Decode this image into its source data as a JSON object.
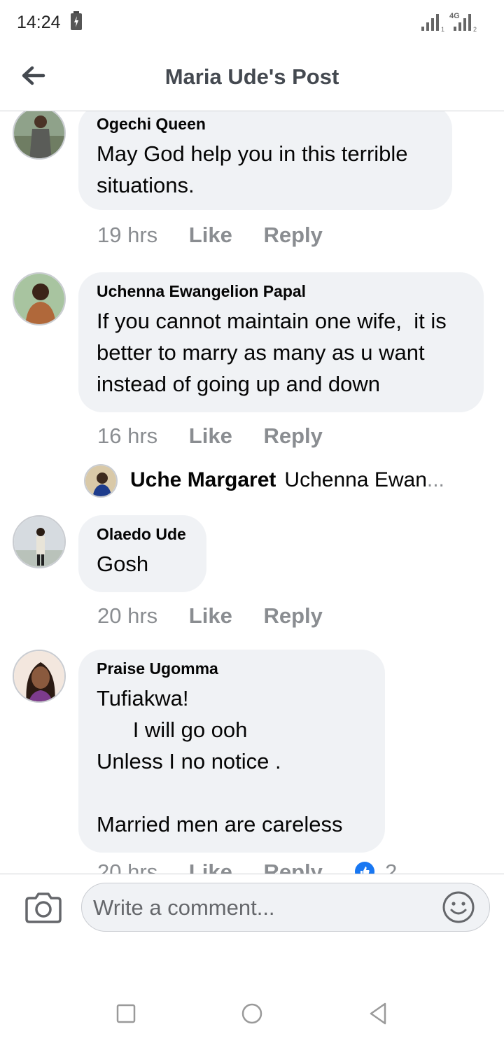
{
  "status_bar": {
    "time": "14:24",
    "network_label": "4G",
    "sim1": "1",
    "sim2": "2"
  },
  "header": {
    "title": "Maria Ude's Post"
  },
  "comments": [
    {
      "author": "Ogechi Queen",
      "text": "May God help you in this terrible situations.",
      "time": "19 hrs",
      "like_label": "Like",
      "reply_label": "Reply"
    },
    {
      "author": "Uchenna Ewangelion Papal",
      "text": "If you cannot maintain one wife,  it is better to marry as many as u want instead of going up and down",
      "time": "16 hrs",
      "like_label": "Like",
      "reply_label": "Reply",
      "reply_preview": {
        "author": "Uche Margaret",
        "text": "Uchenna Ewan",
        "ellipsis": "..."
      }
    },
    {
      "author": "Olaedo Ude",
      "text": "Gosh",
      "time": "20 hrs",
      "like_label": "Like",
      "reply_label": "Reply"
    },
    {
      "author": "Praise Ugomma",
      "text": "Tufiakwa!\n      I will go ooh\nUnless I no notice .\n\nMarried men are careless",
      "time": "20 hrs",
      "like_label": "Like",
      "reply_label": "Reply",
      "reaction_count": "2"
    }
  ],
  "composer": {
    "placeholder": "Write a comment..."
  },
  "colors": {
    "bubble": "#f0f2f5",
    "meta_text": "#8a8d91",
    "title": "#444950",
    "like_blue": "#1877f2"
  },
  "icons": [
    "back-arrow-icon",
    "camera-icon",
    "smiley-icon",
    "recent-apps-icon",
    "home-icon",
    "back-triangle-icon"
  ]
}
